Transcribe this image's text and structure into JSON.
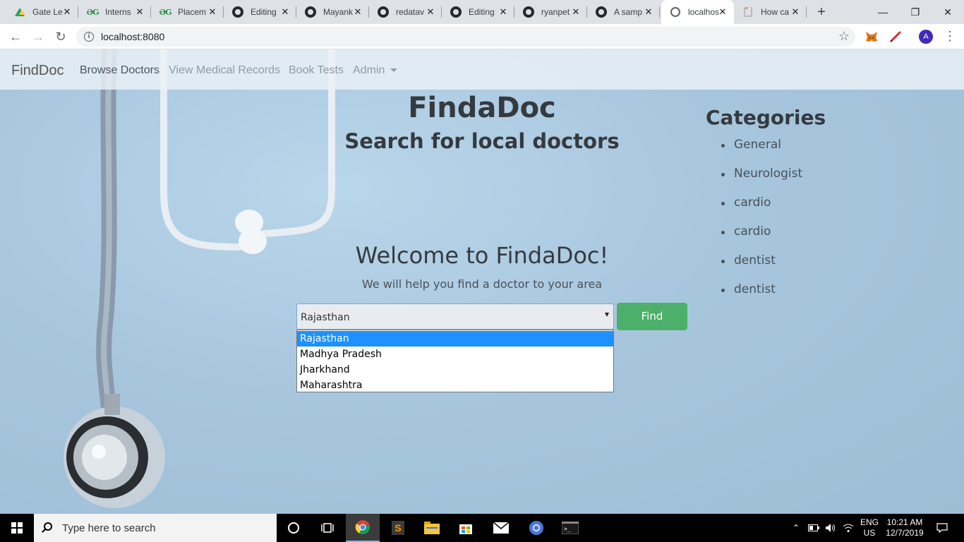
{
  "browser": {
    "tabs": [
      {
        "title": "Gate Le",
        "icon": "google-drive-icon"
      },
      {
        "title": "Interns",
        "icon": "geeksforgeeks-icon"
      },
      {
        "title": "Placem",
        "icon": "geeksforgeeks-icon"
      },
      {
        "title": "Editing",
        "icon": "github-icon"
      },
      {
        "title": "Mayank",
        "icon": "github-icon"
      },
      {
        "title": "redatav",
        "icon": "github-icon"
      },
      {
        "title": "Editing",
        "icon": "github-icon"
      },
      {
        "title": "ryanpet",
        "icon": "github-icon"
      },
      {
        "title": "A samp",
        "icon": "github-icon"
      },
      {
        "title": "localhos",
        "icon": "globe-icon"
      },
      {
        "title": "How ca",
        "icon": "stackoverflow-icon"
      }
    ],
    "active_tab": 9,
    "url": "localhost:8080",
    "profile_initial": "A"
  },
  "navbar": {
    "brand": "FindDoc",
    "links": [
      "Browse Doctors",
      "View Medical Records",
      "Book Tests",
      "Admin"
    ]
  },
  "hero": {
    "title": "FindaDoc",
    "subtitle": "Search for local doctors",
    "welcome": "Welcome to FindaDoc!",
    "tagline": "We will help you find a doctor to your area"
  },
  "categories": {
    "heading": "Categories",
    "items": [
      "General",
      "Neurologist",
      "cardio",
      "cardio",
      "dentist",
      "dentist"
    ]
  },
  "search": {
    "selected": "Rajasthan",
    "options": [
      "Rajasthan",
      "Madhya Pradesh",
      "Jharkhand",
      "Maharashtra"
    ],
    "button_label": "Find"
  },
  "taskbar": {
    "search_placeholder": "Type here to search",
    "lang_top": "ENG",
    "lang_bottom": "US",
    "time": "10:21 AM",
    "date": "12/7/2019"
  },
  "colors": {
    "accent_find": "#4caf6a",
    "dropdown_highlight": "#1e90ff",
    "page_bg": "#a9c8df"
  }
}
